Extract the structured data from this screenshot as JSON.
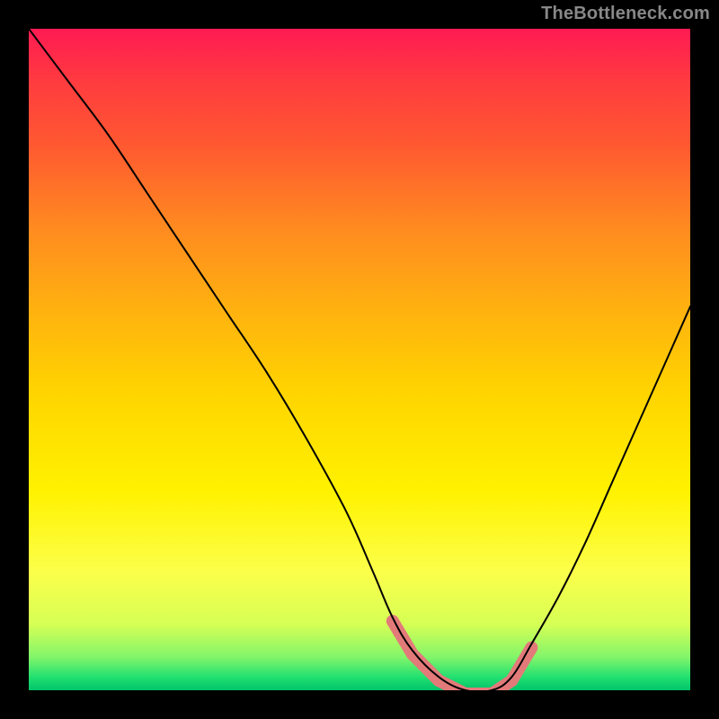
{
  "watermark": "TheBottleneck.com",
  "colors": {
    "frame": "#000000",
    "band": "#e37a7a",
    "curve": "#000000"
  },
  "chart_data": {
    "type": "line",
    "title": "",
    "xlabel": "",
    "ylabel": "",
    "xlim": [
      0,
      100
    ],
    "ylim": [
      0,
      100
    ],
    "grid": false,
    "series": [
      {
        "name": "bottleneck-curve",
        "x": [
          0,
          6,
          12,
          18,
          24,
          30,
          36,
          42,
          48,
          52,
          55,
          58,
          62,
          66,
          70,
          73,
          76,
          80,
          84,
          88,
          92,
          96,
          100
        ],
        "values": [
          100,
          92,
          84,
          75,
          66,
          57,
          48,
          38,
          27,
          18,
          11,
          6,
          2,
          0,
          0,
          2,
          7,
          14,
          22,
          31,
          40,
          49,
          58
        ]
      }
    ],
    "highlight_band": {
      "x_start": 55,
      "x_end": 76,
      "color": "#e37a7a"
    },
    "background_gradient": {
      "direction": "vertical",
      "stops": [
        {
          "pos": 0.0,
          "hex": "#ff1a53"
        },
        {
          "pos": 0.18,
          "hex": "#ff5a30"
        },
        {
          "pos": 0.42,
          "hex": "#ffb010"
        },
        {
          "pos": 0.7,
          "hex": "#fff200"
        },
        {
          "pos": 0.9,
          "hex": "#d6ff55"
        },
        {
          "pos": 1.0,
          "hex": "#00c46a"
        }
      ]
    }
  }
}
